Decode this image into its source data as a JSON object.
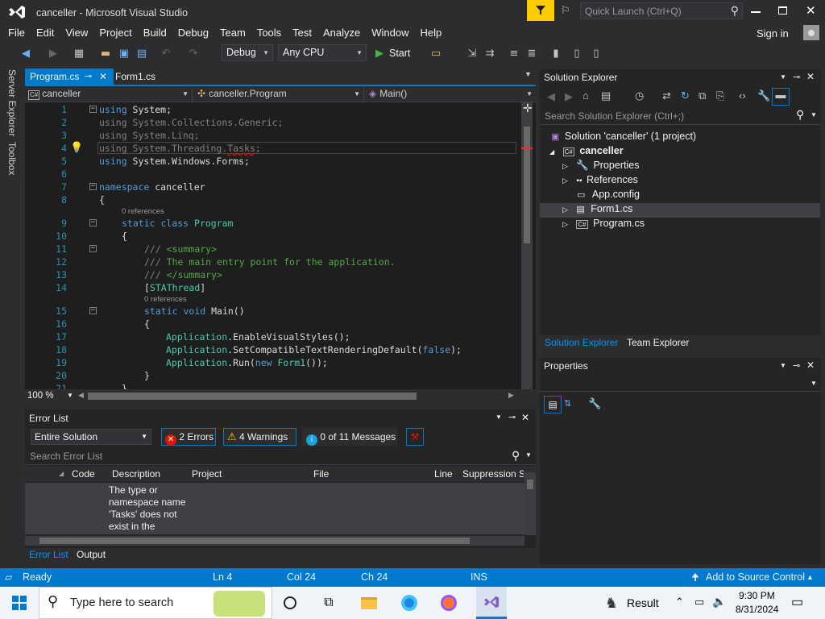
{
  "window": {
    "title": "canceller - Microsoft Visual Studio",
    "quick_launch_placeholder": "Quick Launch (Ctrl+Q)",
    "sign_in": "Sign in"
  },
  "menu": [
    "File",
    "Edit",
    "View",
    "Project",
    "Build",
    "Debug",
    "Team",
    "Tools",
    "Test",
    "Analyze",
    "Window",
    "Help"
  ],
  "toolbar": {
    "config": "Debug",
    "platform": "Any CPU",
    "start": "Start"
  },
  "left_tabs": [
    "Server Explorer",
    "Toolbox"
  ],
  "doc_tabs": [
    {
      "label": "Program.cs",
      "active": true
    },
    {
      "label": "Form1.cs",
      "active": false
    }
  ],
  "nav": {
    "project": "canceller",
    "class": "canceller.Program",
    "member": "Main()"
  },
  "editor": {
    "zoom": "100 %",
    "references_label": "0 references",
    "lines": [
      {
        "n": "1",
        "t": "using System;"
      },
      {
        "n": "2",
        "t": "using System.Collections.Generic;"
      },
      {
        "n": "3",
        "t": "using System.Linq;"
      },
      {
        "n": "4",
        "t": "using System.Threading.Tasks;"
      },
      {
        "n": "5",
        "t": "using System.Windows.Forms;"
      },
      {
        "n": "6",
        "t": ""
      },
      {
        "n": "7",
        "t": "namespace canceller"
      },
      {
        "n": "8",
        "t": "{"
      },
      {
        "n": "9",
        "t": "static class Program"
      },
      {
        "n": "10",
        "t": "{"
      },
      {
        "n": "11",
        "t": "/// <summary>"
      },
      {
        "n": "12",
        "t": "/// The main entry point for the application."
      },
      {
        "n": "13",
        "t": "/// </summary>"
      },
      {
        "n": "14",
        "t": "[STAThread]"
      },
      {
        "n": "15",
        "t": "static void Main()"
      },
      {
        "n": "16",
        "t": "{"
      },
      {
        "n": "17",
        "t": "Application.EnableVisualStyles();"
      },
      {
        "n": "18",
        "t": "Application.SetCompatibleTextRenderingDefault(false);"
      },
      {
        "n": "19",
        "t": "Application.Run(new Form1());"
      },
      {
        "n": "20",
        "t": "}"
      },
      {
        "n": "21",
        "t": "}"
      }
    ]
  },
  "error_list": {
    "title": "Error List",
    "scope": "Entire Solution",
    "errors": "2 Errors",
    "warnings": "4 Warnings",
    "messages": "0 of 11 Messages",
    "search_placeholder": "Search Error List",
    "columns": [
      "Code",
      "Description",
      "Project",
      "File",
      "Line",
      "Suppression S"
    ],
    "rows": [
      {
        "code": "",
        "description": "The type or namespace name 'Tasks' does not exist in the",
        "project": "",
        "file": "",
        "line": ""
      }
    ],
    "tabs": [
      "Error List",
      "Output"
    ]
  },
  "solution_explorer": {
    "title": "Solution Explorer",
    "search_placeholder": "Search Solution Explorer (Ctrl+;)",
    "solution": "Solution 'canceller' (1 project)",
    "project": "canceller",
    "items": [
      "Properties",
      "References",
      "App.config",
      "Form1.cs",
      "Program.cs"
    ],
    "tabs": [
      "Solution Explorer",
      "Team Explorer"
    ]
  },
  "properties": {
    "title": "Properties"
  },
  "status": {
    "ready": "Ready",
    "ln": "Ln 4",
    "col": "Col 24",
    "ch": "Ch 24",
    "ins": "INS",
    "source_control": "Add to Source Control"
  },
  "taskbar": {
    "search_placeholder": "Type here to search",
    "result": "Result",
    "time": "9:30 PM",
    "date": "8/31/2024"
  },
  "colors": {
    "accent": "#007acc",
    "background": "#2d2d30",
    "editor": "#1e1e1e",
    "keyword": "#569cd6",
    "type": "#4ec9b0",
    "comment": "#57a64a"
  }
}
